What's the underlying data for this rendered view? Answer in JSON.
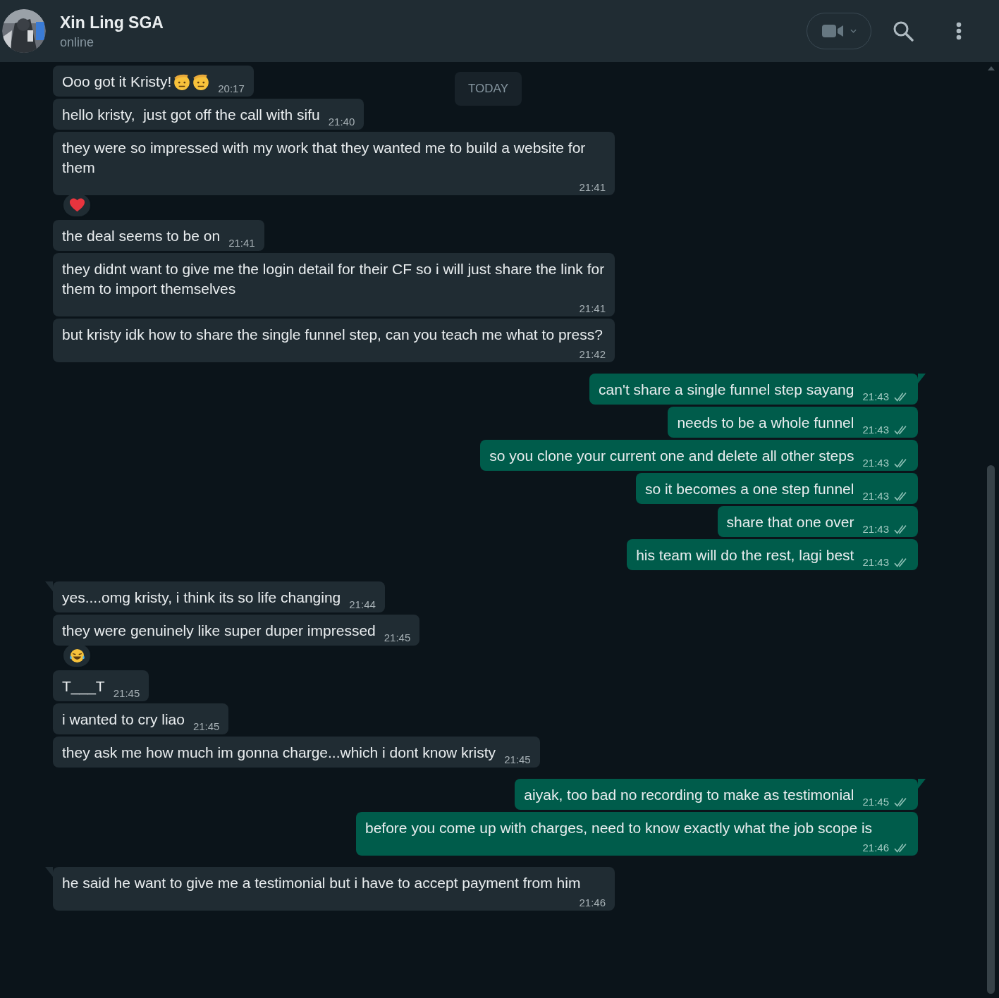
{
  "header": {
    "contact_name": "Xin Ling SGA",
    "status": "online"
  },
  "date_chip": "TODAY",
  "messages": [
    {
      "kind": "in",
      "group_start": false,
      "text": "Ooo got it Kristy!",
      "emoji": [
        {
          "kind": "salute"
        },
        {
          "kind": "salute"
        }
      ],
      "time": "20:17"
    },
    {
      "kind": "in",
      "group_start": false,
      "text": "hello kristy,  just got off the call with sifu",
      "time": "21:40"
    },
    {
      "kind": "in",
      "group_start": false,
      "text": "they were so impressed with my work that they wanted me to build a website for them",
      "time": "21:41",
      "reaction": {
        "kind": "heart"
      }
    },
    {
      "kind": "in",
      "group_start": false,
      "text": "the deal seems to be on",
      "time": "21:41"
    },
    {
      "kind": "in",
      "group_start": false,
      "text": "they didnt want to give me the login detail for their CF so i will just share the link for them to import themselves",
      "time": "21:41"
    },
    {
      "kind": "in",
      "group_start": false,
      "text": "but kristy idk how to share the single funnel step, can you teach me what to press?",
      "time": "21:42"
    },
    {
      "kind": "out",
      "group_start": true,
      "text": "can't share a single funnel step sayang",
      "time": "21:43",
      "delivered": true
    },
    {
      "kind": "out",
      "group_start": false,
      "text": "needs to be a whole funnel",
      "time": "21:43",
      "delivered": true
    },
    {
      "kind": "out",
      "group_start": false,
      "text": "so you clone your current one and delete all other steps",
      "time": "21:43",
      "delivered": true
    },
    {
      "kind": "out",
      "group_start": false,
      "text": "so it becomes a one step funnel",
      "time": "21:43",
      "delivered": true
    },
    {
      "kind": "out",
      "group_start": false,
      "text": "share that one over",
      "time": "21:43",
      "delivered": true
    },
    {
      "kind": "out",
      "group_start": false,
      "text": "his team will do the rest, lagi best",
      "time": "21:43",
      "delivered": true
    },
    {
      "kind": "in",
      "group_start": true,
      "text": "yes....omg kristy, i think its so life changing",
      "time": "21:44"
    },
    {
      "kind": "in",
      "group_start": false,
      "text": "they were genuinely like super duper impressed",
      "time": "21:45",
      "reaction": {
        "kind": "laugh"
      }
    },
    {
      "kind": "in",
      "group_start": false,
      "text": "T___T",
      "time": "21:45"
    },
    {
      "kind": "in",
      "group_start": false,
      "text": "i wanted to cry liao",
      "time": "21:45"
    },
    {
      "kind": "in",
      "group_start": false,
      "text": "they ask me how much im gonna charge...which i dont know kristy",
      "time": "21:45"
    },
    {
      "kind": "out",
      "group_start": true,
      "text": "aiyak, too bad no recording to make as testimonial",
      "time": "21:45",
      "delivered": true
    },
    {
      "kind": "out",
      "group_start": false,
      "text": "before you come up with charges, need to know exactly what the job scope is",
      "time": "21:46",
      "delivered": true
    },
    {
      "kind": "in",
      "group_start": true,
      "text": "he said he want to give me a testimonial but i have to accept payment from him",
      "time": "21:46"
    }
  ]
}
